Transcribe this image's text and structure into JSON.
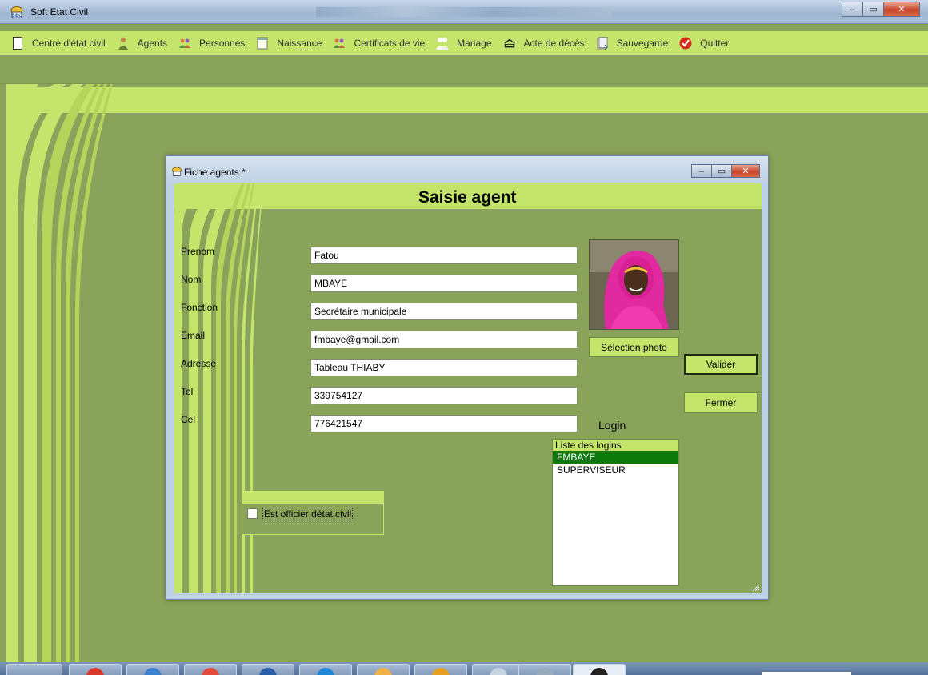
{
  "window": {
    "title": "Soft Etat Civil",
    "minimize": "–",
    "maximize": "▭",
    "close": "✕"
  },
  "menu": [
    {
      "label": "Centre d'état civil",
      "icon": "document-icon"
    },
    {
      "label": "Agents",
      "icon": "person-icon"
    },
    {
      "label": "Personnes",
      "icon": "people-icon"
    },
    {
      "label": "Naissance",
      "icon": "notepad-icon"
    },
    {
      "label": "Certificats de vie",
      "icon": "people-icon"
    },
    {
      "label": "Mariage",
      "icon": "couple-icon"
    },
    {
      "label": "Acte de décès",
      "icon": "coffin-icon"
    },
    {
      "label": "Sauvegarde",
      "icon": "save-icon"
    },
    {
      "label": "Quitter",
      "icon": "check-red-icon"
    }
  ],
  "child": {
    "title": "Fiche agents *",
    "form_title": "Saisie agent",
    "fields": [
      {
        "label": "Prenom",
        "value": "Fatou"
      },
      {
        "label": "Nom",
        "value": "MBAYE"
      },
      {
        "label": "Fonction",
        "value": "Secrétaire municipale"
      },
      {
        "label": "Email",
        "value": "fmbaye@gmail.com"
      },
      {
        "label": "Adresse",
        "value": "Tableau THIABY"
      },
      {
        "label": "Tel",
        "value": "339754127"
      },
      {
        "label": "Cel",
        "value": "776421547"
      }
    ],
    "select_photo": "Sélection photo",
    "valider": "Valider",
    "fermer": "Fermer",
    "login_label": "Login",
    "logins": {
      "header": "Liste des logins",
      "items": [
        "FMBAYE",
        "SUPERVISEUR"
      ],
      "selected": "FMBAYE"
    },
    "officer_checkbox": {
      "label": "Est officier détat civil",
      "checked": false
    }
  },
  "colors": {
    "light_green": "#c5e46c",
    "olive": "#8aa35b",
    "selected": "#0b7a0b"
  }
}
